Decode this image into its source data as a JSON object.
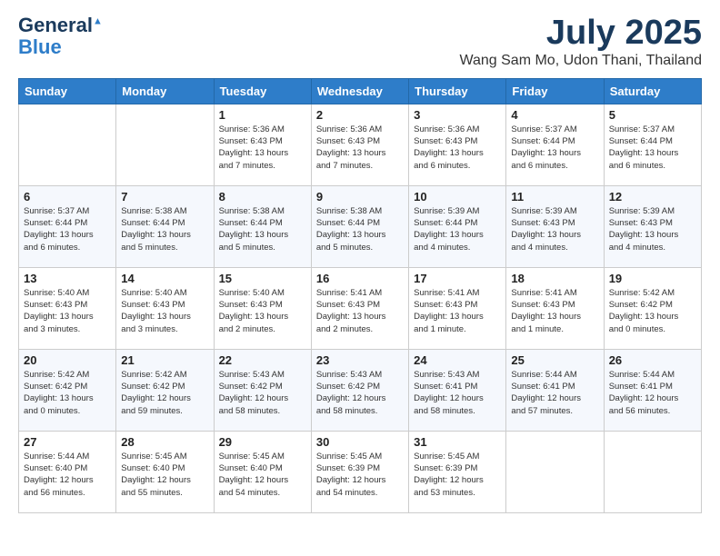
{
  "header": {
    "logo_line1": "General",
    "logo_line2": "Blue",
    "title": "July 2025",
    "subtitle": "Wang Sam Mo, Udon Thani, Thailand"
  },
  "weekdays": [
    "Sunday",
    "Monday",
    "Tuesday",
    "Wednesday",
    "Thursday",
    "Friday",
    "Saturday"
  ],
  "weeks": [
    [
      {
        "day": "",
        "detail": ""
      },
      {
        "day": "",
        "detail": ""
      },
      {
        "day": "1",
        "detail": "Sunrise: 5:36 AM\nSunset: 6:43 PM\nDaylight: 13 hours\nand 7 minutes."
      },
      {
        "day": "2",
        "detail": "Sunrise: 5:36 AM\nSunset: 6:43 PM\nDaylight: 13 hours\nand 7 minutes."
      },
      {
        "day": "3",
        "detail": "Sunrise: 5:36 AM\nSunset: 6:43 PM\nDaylight: 13 hours\nand 6 minutes."
      },
      {
        "day": "4",
        "detail": "Sunrise: 5:37 AM\nSunset: 6:44 PM\nDaylight: 13 hours\nand 6 minutes."
      },
      {
        "day": "5",
        "detail": "Sunrise: 5:37 AM\nSunset: 6:44 PM\nDaylight: 13 hours\nand 6 minutes."
      }
    ],
    [
      {
        "day": "6",
        "detail": "Sunrise: 5:37 AM\nSunset: 6:44 PM\nDaylight: 13 hours\nand 6 minutes."
      },
      {
        "day": "7",
        "detail": "Sunrise: 5:38 AM\nSunset: 6:44 PM\nDaylight: 13 hours\nand 5 minutes."
      },
      {
        "day": "8",
        "detail": "Sunrise: 5:38 AM\nSunset: 6:44 PM\nDaylight: 13 hours\nand 5 minutes."
      },
      {
        "day": "9",
        "detail": "Sunrise: 5:38 AM\nSunset: 6:44 PM\nDaylight: 13 hours\nand 5 minutes."
      },
      {
        "day": "10",
        "detail": "Sunrise: 5:39 AM\nSunset: 6:44 PM\nDaylight: 13 hours\nand 4 minutes."
      },
      {
        "day": "11",
        "detail": "Sunrise: 5:39 AM\nSunset: 6:43 PM\nDaylight: 13 hours\nand 4 minutes."
      },
      {
        "day": "12",
        "detail": "Sunrise: 5:39 AM\nSunset: 6:43 PM\nDaylight: 13 hours\nand 4 minutes."
      }
    ],
    [
      {
        "day": "13",
        "detail": "Sunrise: 5:40 AM\nSunset: 6:43 PM\nDaylight: 13 hours\nand 3 minutes."
      },
      {
        "day": "14",
        "detail": "Sunrise: 5:40 AM\nSunset: 6:43 PM\nDaylight: 13 hours\nand 3 minutes."
      },
      {
        "day": "15",
        "detail": "Sunrise: 5:40 AM\nSunset: 6:43 PM\nDaylight: 13 hours\nand 2 minutes."
      },
      {
        "day": "16",
        "detail": "Sunrise: 5:41 AM\nSunset: 6:43 PM\nDaylight: 13 hours\nand 2 minutes."
      },
      {
        "day": "17",
        "detail": "Sunrise: 5:41 AM\nSunset: 6:43 PM\nDaylight: 13 hours\nand 1 minute."
      },
      {
        "day": "18",
        "detail": "Sunrise: 5:41 AM\nSunset: 6:43 PM\nDaylight: 13 hours\nand 1 minute."
      },
      {
        "day": "19",
        "detail": "Sunrise: 5:42 AM\nSunset: 6:42 PM\nDaylight: 13 hours\nand 0 minutes."
      }
    ],
    [
      {
        "day": "20",
        "detail": "Sunrise: 5:42 AM\nSunset: 6:42 PM\nDaylight: 13 hours\nand 0 minutes."
      },
      {
        "day": "21",
        "detail": "Sunrise: 5:42 AM\nSunset: 6:42 PM\nDaylight: 12 hours\nand 59 minutes."
      },
      {
        "day": "22",
        "detail": "Sunrise: 5:43 AM\nSunset: 6:42 PM\nDaylight: 12 hours\nand 58 minutes."
      },
      {
        "day": "23",
        "detail": "Sunrise: 5:43 AM\nSunset: 6:42 PM\nDaylight: 12 hours\nand 58 minutes."
      },
      {
        "day": "24",
        "detail": "Sunrise: 5:43 AM\nSunset: 6:41 PM\nDaylight: 12 hours\nand 58 minutes."
      },
      {
        "day": "25",
        "detail": "Sunrise: 5:44 AM\nSunset: 6:41 PM\nDaylight: 12 hours\nand 57 minutes."
      },
      {
        "day": "26",
        "detail": "Sunrise: 5:44 AM\nSunset: 6:41 PM\nDaylight: 12 hours\nand 56 minutes."
      }
    ],
    [
      {
        "day": "27",
        "detail": "Sunrise: 5:44 AM\nSunset: 6:40 PM\nDaylight: 12 hours\nand 56 minutes."
      },
      {
        "day": "28",
        "detail": "Sunrise: 5:45 AM\nSunset: 6:40 PM\nDaylight: 12 hours\nand 55 minutes."
      },
      {
        "day": "29",
        "detail": "Sunrise: 5:45 AM\nSunset: 6:40 PM\nDaylight: 12 hours\nand 54 minutes."
      },
      {
        "day": "30",
        "detail": "Sunrise: 5:45 AM\nSunset: 6:39 PM\nDaylight: 12 hours\nand 54 minutes."
      },
      {
        "day": "31",
        "detail": "Sunrise: 5:45 AM\nSunset: 6:39 PM\nDaylight: 12 hours\nand 53 minutes."
      },
      {
        "day": "",
        "detail": ""
      },
      {
        "day": "",
        "detail": ""
      }
    ]
  ]
}
